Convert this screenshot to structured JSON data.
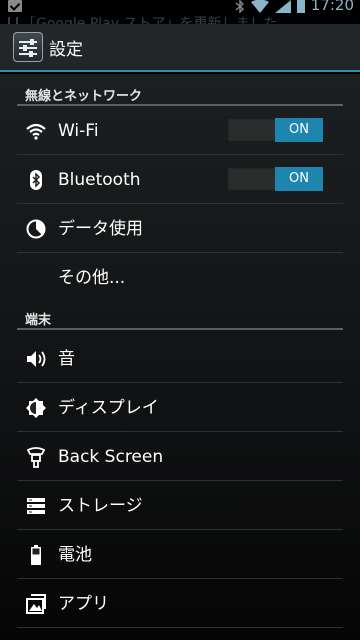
{
  "status_bar": {
    "time": "17:20",
    "ghost_notification": "「Google Play ストア」を更新しました",
    "icons": [
      "check-icon",
      "bluetooth-icon",
      "wifi-icon",
      "signal-icon",
      "battery-icon"
    ]
  },
  "action_bar": {
    "title": "設定",
    "icon": "settings-app-icon"
  },
  "sections": [
    {
      "header": "無線とネットワーク",
      "items": [
        {
          "icon": "wifi-icon",
          "label": "Wi-Fi",
          "toggle": "ON"
        },
        {
          "icon": "bluetooth-icon",
          "label": "Bluetooth",
          "toggle": "ON"
        },
        {
          "icon": "data-usage-icon",
          "label": "データ使用"
        },
        {
          "icon": "",
          "label": "その他..."
        }
      ]
    },
    {
      "header": "端末",
      "items": [
        {
          "icon": "sound-icon",
          "label": "音"
        },
        {
          "icon": "display-icon",
          "label": "ディスプレイ"
        },
        {
          "icon": "back-screen-icon",
          "label": "Back Screen"
        },
        {
          "icon": "storage-icon",
          "label": "ストレージ"
        },
        {
          "icon": "battery-icon",
          "label": "電池"
        },
        {
          "icon": "apps-icon",
          "label": "アプリ"
        }
      ]
    }
  ],
  "colors": {
    "accent": "#1e85ae",
    "action_bar_bg": "#232628",
    "background": "#1c1f21"
  }
}
